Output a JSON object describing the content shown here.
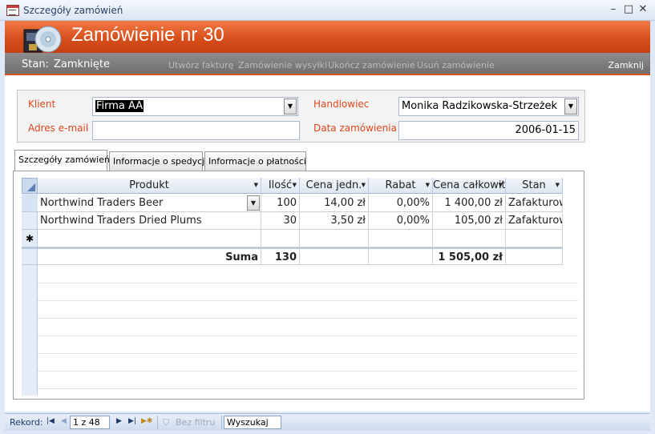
{
  "window": {
    "title": "Szczegóły zamówień",
    "minimize": "–",
    "maximize": "□",
    "close": "✕"
  },
  "header": {
    "title": "Zamówienie nr 30"
  },
  "status": {
    "label": "Stan:",
    "value": "Zamknięte",
    "actions": [
      "Utwórz fakturę",
      "Zamówienie wysyłki",
      "Ukończ zamówienie",
      "Usuń zamówienie"
    ],
    "close_label": "Zamknij"
  },
  "form": {
    "client_label": "Klient",
    "client_value": "Firma AA",
    "email_label": "Adres e-mail",
    "email_value": "",
    "salesperson_label": "Handlowiec",
    "salesperson_value": "Monika Radzikowska-Strzeżek",
    "order_date_label": "Data zamówienia",
    "order_date_value": "2006-01-15"
  },
  "tabs": [
    "Szczegóły zamówień",
    "Informacje o spedycji",
    "Informacje o płatności"
  ],
  "grid": {
    "columns": [
      "Produkt",
      "Ilość",
      "Cena jedn.",
      "Rabat",
      "Cena całkowita",
      "Stan"
    ],
    "rows": [
      [
        "Northwind Traders Beer",
        "100",
        "14,00 zł",
        "0,00%",
        "1 400,00 zł",
        "Zafakturowane"
      ],
      [
        "Northwind Traders Dried Plums",
        "30",
        "3,50 zł",
        "0,00%",
        "105,00 zł",
        "Zafakturowane"
      ]
    ],
    "new_row_marker": "✱",
    "totals": {
      "label": "Suma",
      "quantity": "130",
      "total": "1 505,00 zł"
    }
  },
  "navigation": {
    "label": "Rekord:",
    "position": "1 z 48",
    "filter": "Bez filtru",
    "search": "Wyszukaj"
  },
  "colors": {
    "accent": "#d84f1b",
    "label": "#e0461a",
    "status_bar": "#7a7a7a"
  }
}
